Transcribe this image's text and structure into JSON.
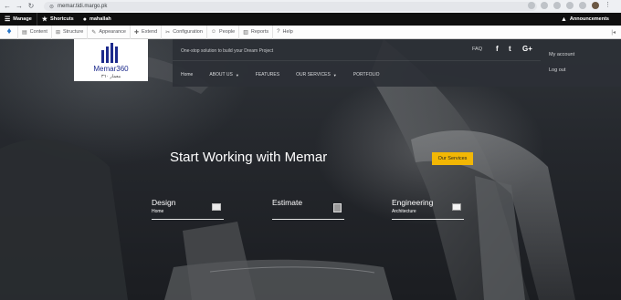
{
  "browser": {
    "url": "memar.tidi.margo.pk"
  },
  "admin_toolbar": {
    "manage": "Manage",
    "shortcuts": "Shortcuts",
    "user": "mahallah",
    "announcements": "Announcements"
  },
  "admin_tray": {
    "items": [
      "Content",
      "Structure",
      "Appearance",
      "Extend",
      "Configuration",
      "People",
      "Reports",
      "Help"
    ],
    "icons": [
      "content-icon",
      "structure-icon",
      "appearance-icon",
      "extend-icon",
      "configuration-icon",
      "people-icon",
      "reports-icon",
      "help-icon"
    ]
  },
  "site": {
    "logo_text": "Memar360",
    "logo_subtitle": "معمار ٣٦٠",
    "tagline": "One-stop solution to build your Dream Project",
    "faq": "FAQ",
    "social": [
      "f",
      "t",
      "G+"
    ],
    "nav": [
      "Home",
      "ABOUT US",
      "FEATURES",
      "OUR SERVICES",
      "PORTFOLIO"
    ],
    "account": "My account",
    "logout": "Log out"
  },
  "hero": {
    "title": "Start Working with Memar",
    "button": "Our Services",
    "features": [
      {
        "title": "Design",
        "subtitle": "Home"
      },
      {
        "title": "Estimate",
        "subtitle": ""
      },
      {
        "title": "Engineering",
        "subtitle": "Architecture"
      }
    ]
  },
  "colors": {
    "accent": "#f2b705",
    "toolbar": "#0f0f0f",
    "brand": "#1c2a8c"
  }
}
